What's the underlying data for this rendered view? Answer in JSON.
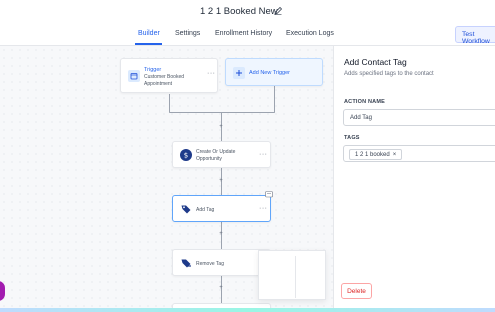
{
  "header": {
    "title": "1 2 1 Booked New"
  },
  "tabs": [
    {
      "label": "Builder",
      "active": true
    },
    {
      "label": "Settings",
      "active": false
    },
    {
      "label": "Enrollment History",
      "active": false
    },
    {
      "label": "Execution Logs",
      "active": false
    }
  ],
  "toolbar": {
    "test_label": "Test Workflow"
  },
  "canvas": {
    "trigger": {
      "title": "Trigger",
      "subtitle": "Customer Booked Appointment"
    },
    "add_trigger": {
      "label": "Add New Trigger"
    },
    "nodes": [
      {
        "label": "Create Or Update Opportunity"
      },
      {
        "label": "Add Tag"
      },
      {
        "label": "Remove Tag"
      }
    ],
    "more_label": "···"
  },
  "panel": {
    "title": "Add Contact Tag",
    "subtitle": "Adds specified tags to the contact",
    "action_name_label": "ACTION NAME",
    "action_name_value": "Add Tag",
    "tags_label": "TAGS",
    "tag_chip": "1 2 1 booked",
    "delete_label": "Delete"
  },
  "colors": {
    "accent": "#2563eb",
    "danger": "#dc2626",
    "node_icon": "#1e3a8a"
  }
}
